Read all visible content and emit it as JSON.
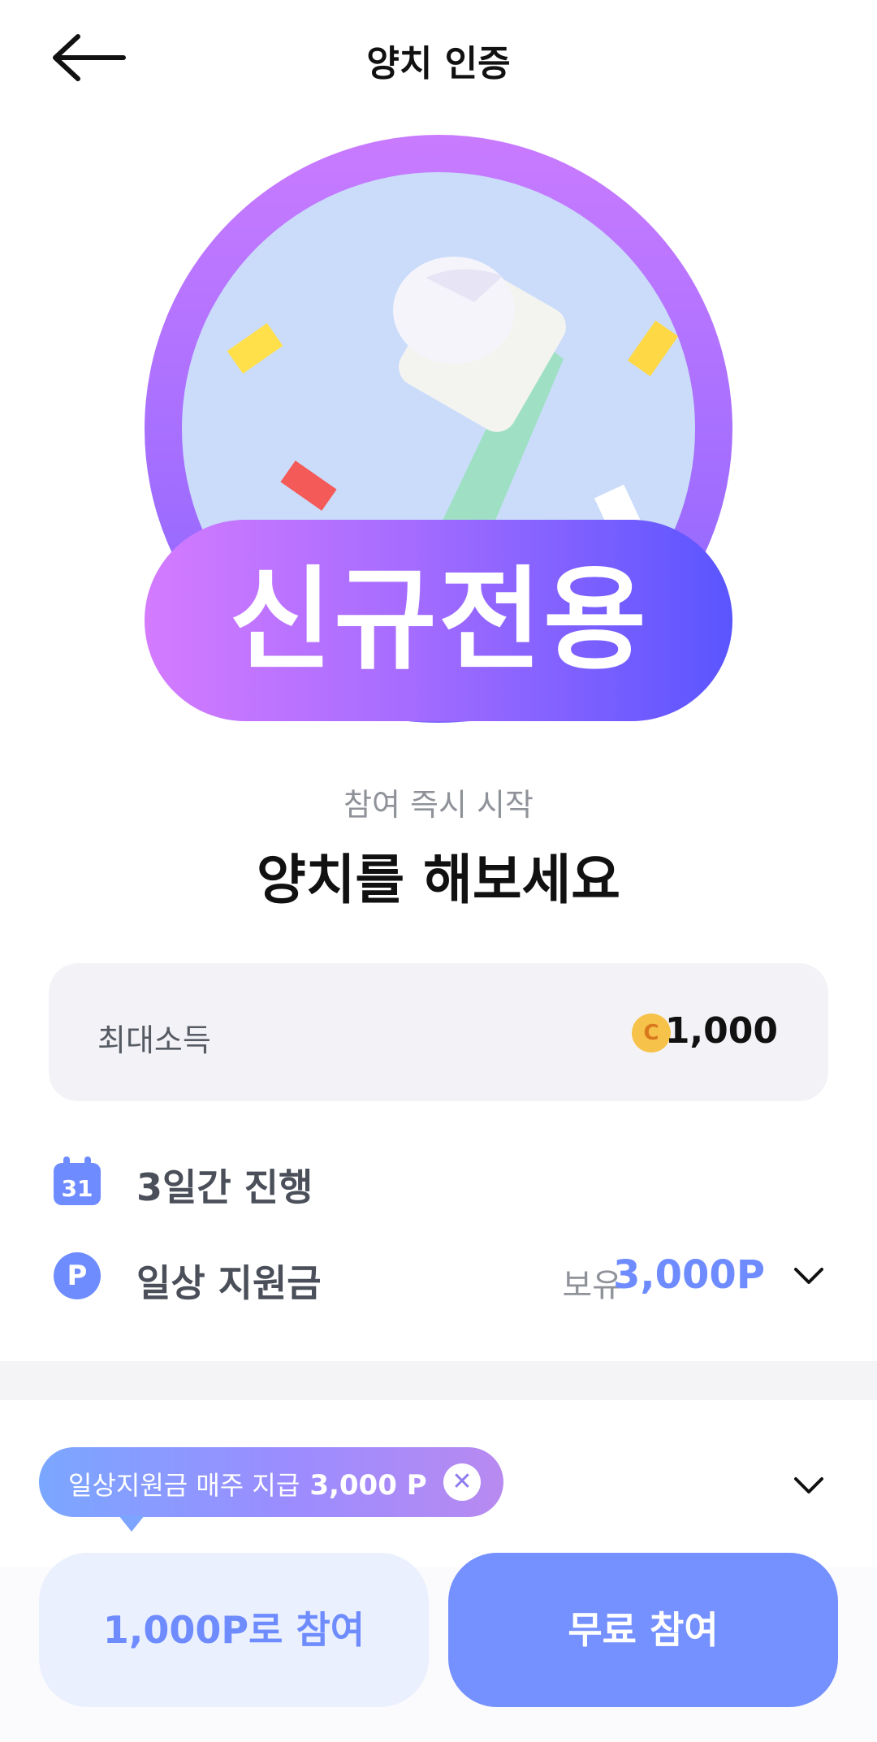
{
  "header": {
    "title": "양치 인증",
    "back_icon": "arrow-left-icon"
  },
  "badge": {
    "text": "신규전용",
    "image": "toothbrush-illustration",
    "colors": {
      "ring": "#b36bff",
      "inner": "#cadcfa"
    }
  },
  "intro": {
    "subtitle": "참여 즉시 시작",
    "title": "양치를 해보세요"
  },
  "income": {
    "label": "최대소득",
    "coin_icon": "coin-icon",
    "coin_letter": "C",
    "value": "1,000"
  },
  "duration": {
    "icon": "calendar-icon",
    "icon_text": "31",
    "label": "3일간 진행"
  },
  "support": {
    "icon": "points-icon",
    "icon_text": "P",
    "label": "일상 지원금",
    "own_label": "보유",
    "own_value": "3,000P"
  },
  "tooltip": {
    "text": "일상지원금 매주 지급",
    "amount": "3,000 P",
    "close_icon": "close-icon"
  },
  "buttons": {
    "paid": "1,000P로 참여",
    "free": "무료 참여"
  },
  "colors": {
    "accent": "#6f8cff",
    "accent_light": "#eaf0fd"
  }
}
